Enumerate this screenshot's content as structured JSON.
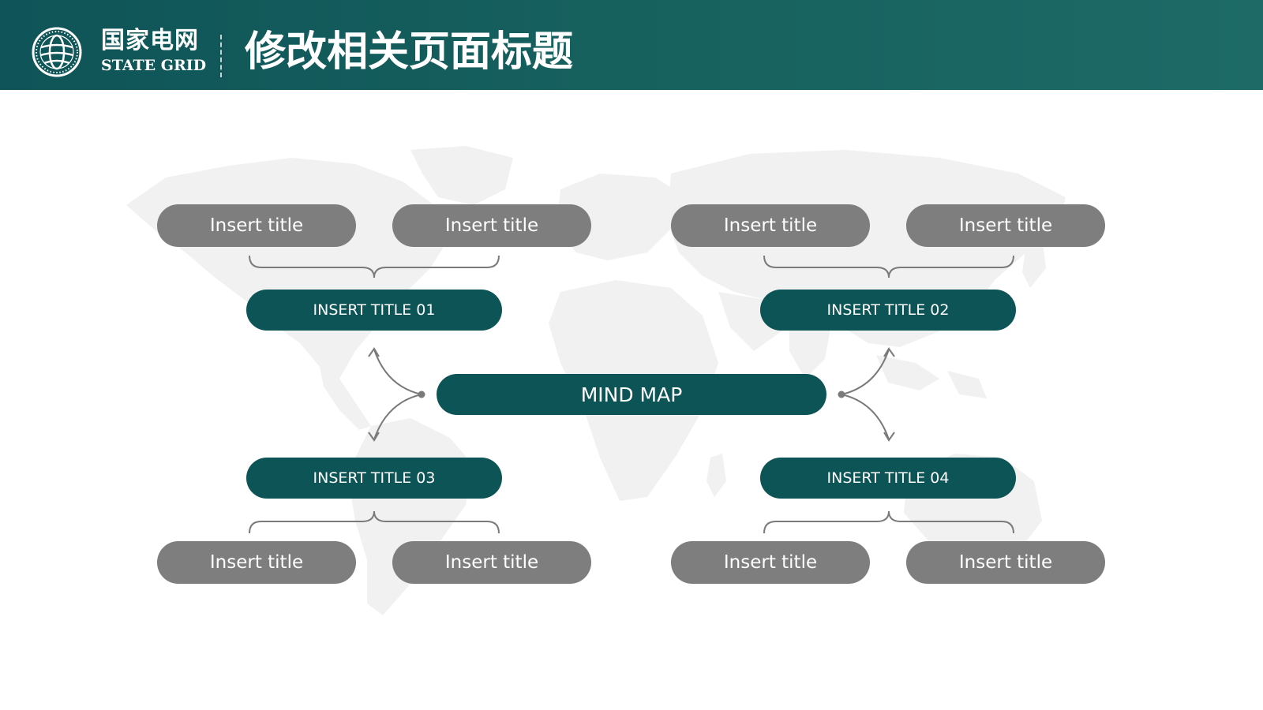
{
  "header": {
    "brand_cn": "国家电网",
    "brand_en": "STATE GRID",
    "page_title": "修改相关页面标题"
  },
  "colors": {
    "header_bg": "#16605e",
    "teal_box": "#0d5457",
    "grey_box": "#7e7e7e",
    "connector": "#7a7a7a",
    "map": "#f0f1f0"
  },
  "diagram": {
    "center_label": "MIND MAP",
    "branches": [
      {
        "label": "INSERT TITLE 01",
        "children": [
          "Insert title",
          "Insert title"
        ]
      },
      {
        "label": "INSERT TITLE 02",
        "children": [
          "Insert title",
          "Insert title"
        ]
      },
      {
        "label": "INSERT TITLE 03",
        "children": [
          "Insert title",
          "Insert title"
        ]
      },
      {
        "label": "INSERT TITLE 04",
        "children": [
          "Insert title",
          "Insert title"
        ]
      }
    ]
  }
}
